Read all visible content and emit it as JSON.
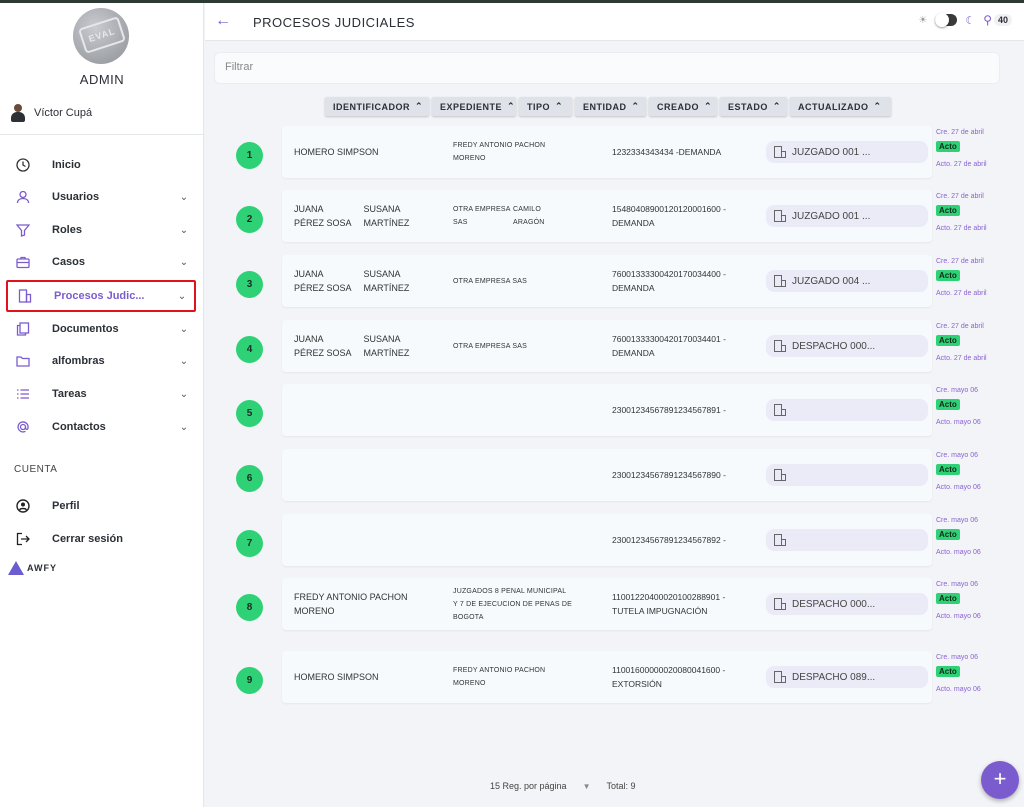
{
  "sidebar": {
    "role": "ADMIN",
    "user_name": "Víctor Cupá",
    "items": [
      {
        "label": "Inicio",
        "icon": "clock-icon",
        "chevron": false
      },
      {
        "label": "Usuarios",
        "icon": "user-icon",
        "chevron": true
      },
      {
        "label": "Roles",
        "icon": "funnel-icon",
        "chevron": true
      },
      {
        "label": "Casos",
        "icon": "briefcase-icon",
        "chevron": true
      },
      {
        "label": "Procesos Judic...",
        "icon": "building-icon",
        "chevron": true,
        "active": true
      },
      {
        "label": "Documentos",
        "icon": "documents-icon",
        "chevron": true
      },
      {
        "label": "alfombras",
        "icon": "folder-icon",
        "chevron": true
      },
      {
        "label": "Tareas",
        "icon": "list-icon",
        "chevron": true
      },
      {
        "label": "Contactos",
        "icon": "at-icon",
        "chevron": true
      }
    ],
    "section_account": "CUENTA",
    "account_items": [
      {
        "label": "Perfil",
        "icon": "profile-icon"
      },
      {
        "label": "Cerrar sesión",
        "icon": "logout-icon"
      }
    ],
    "logo_text": "AWFY"
  },
  "header": {
    "title": "PROCESOS JUDICIALES",
    "notifications": "40"
  },
  "filter": {
    "placeholder": "Filtrar"
  },
  "columns": [
    "IDENTIFICADOR",
    "EXPEDIENTE",
    "TIPO",
    "ENTIDAD",
    "CREADO",
    "ESTADO",
    "ACTUALIZADO"
  ],
  "rows": [
    {
      "n": "1",
      "names": [
        [
          "HOMERO SIMPSON"
        ]
      ],
      "exp": [
        "FREDY ANTONIO PACHON",
        "MORENO"
      ],
      "id": [
        "1232334343434 -DEMANDA"
      ],
      "entity": "JUZGADO 001 ...",
      "created": "Cre. 27 de abril",
      "status": "Acto",
      "updated": "Acto. 27 de abril"
    },
    {
      "n": "2",
      "names": [
        [
          "JUANA",
          "PÉREZ SOSA"
        ],
        [
          "SUSANA",
          "MARTÍNEZ"
        ]
      ],
      "exp_pair": [
        [
          "OTRA EMPRESA",
          "SAS"
        ],
        [
          "CAMILO",
          "ARAGÓN"
        ]
      ],
      "id": [
        "1548040890012012000160​0 -",
        "DEMANDA"
      ],
      "entity": "JUZGADO 001 ...",
      "created": "Cre. 27 de abril",
      "status": "Acto",
      "updated": "Acto. 27 de abril"
    },
    {
      "n": "3",
      "names": [
        [
          "JUANA",
          "PÉREZ SOSA"
        ],
        [
          "SUSANA",
          "MARTÍNEZ"
        ]
      ],
      "exp": [
        "OTRA EMPRESA SAS"
      ],
      "id": [
        "76001333300420170034400 -",
        "DEMANDA"
      ],
      "entity": "JUZGADO 004 ...",
      "created": "Cre. 27 de abril",
      "status": "Acto",
      "updated": "Acto. 27 de abril"
    },
    {
      "n": "4",
      "names": [
        [
          "JUANA",
          "PÉREZ SOSA"
        ],
        [
          "SUSANA",
          "MARTÍNEZ"
        ]
      ],
      "exp": [
        "OTRA EMPRESA SAS"
      ],
      "id": [
        "76001333300420170034401 -",
        "DEMANDA"
      ],
      "entity": "DESPACHO 000...",
      "created": "Cre. 27 de abril",
      "status": "Acto",
      "updated": "Acto. 27 de abril"
    },
    {
      "n": "5",
      "names": [],
      "exp": [],
      "id": [
        "23001234567891234567891 -"
      ],
      "entity": "",
      "created": "Cre. mayo 06",
      "status": "Acto",
      "updated": "Acto. mayo 06"
    },
    {
      "n": "6",
      "names": [],
      "exp": [],
      "id": [
        "23001234567891234567890 -"
      ],
      "entity": "",
      "created": "Cre. mayo 06",
      "status": "Acto",
      "updated": "Acto. mayo 06"
    },
    {
      "n": "7",
      "names": [],
      "exp": [],
      "id": [
        "23001234567891234567892 -"
      ],
      "entity": "",
      "created": "Cre. mayo 06",
      "status": "Acto",
      "updated": "Acto. mayo 06"
    },
    {
      "n": "8",
      "names": [
        [
          "FREDY ANTONIO PACHON",
          "MORENO"
        ]
      ],
      "exp": [
        "JUZGADOS 8 PENAL MUNICIPAL",
        "Y 7 DE EJECUCION DE PENAS DE",
        "BOGOTA"
      ],
      "id": [
        "11001220400020100288901 -",
        "TUTELA IMPUGNACIÓN"
      ],
      "entity": "DESPACHO 000...",
      "created": "Cre. mayo 06",
      "status": "Acto",
      "updated": "Acto. mayo 06"
    },
    {
      "n": "9",
      "names": [
        [
          "HOMERO SIMPSON"
        ]
      ],
      "exp": [
        "FREDY ANTONIO PACHON",
        "MORENO"
      ],
      "id": [
        "11001600000020080041600 -",
        "EXTORSIÓN"
      ],
      "entity": "DESPACHO 089...",
      "created": "Cre. mayo 06",
      "status": "Acto",
      "updated": "Acto. mayo 06"
    }
  ],
  "pagination": {
    "per_page": "15 Reg. por página",
    "total": "Total: 9"
  },
  "colors": {
    "accent": "#7b5ccf",
    "status_green": "#2fd177",
    "highlight": "#e0121b"
  }
}
